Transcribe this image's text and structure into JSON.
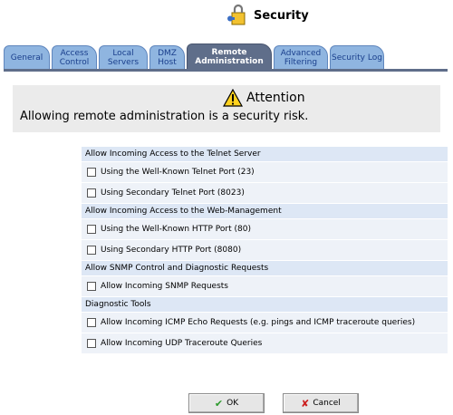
{
  "header": {
    "title": "Security",
    "icon": "lock-key-icon"
  },
  "tabs": [
    {
      "label": "General",
      "active": false
    },
    {
      "label": "Access Control",
      "active": false
    },
    {
      "label": "Local Servers",
      "active": false
    },
    {
      "label": "DMZ Host",
      "active": false
    },
    {
      "label": "Remote Administration",
      "active": true
    },
    {
      "label": "Advanced Filtering",
      "active": false
    },
    {
      "label": "Security Log",
      "active": false
    }
  ],
  "attention": {
    "title": "Attention",
    "message": "Allowing remote administration is a security risk."
  },
  "sections": [
    {
      "title": "Allow Incoming Access to the Telnet Server",
      "items": [
        {
          "label": "Using the Well-Known Telnet Port (23)",
          "checked": false
        },
        {
          "label": "Using Secondary Telnet Port (8023)",
          "checked": false
        }
      ]
    },
    {
      "title": "Allow Incoming Access to the Web-Management",
      "items": [
        {
          "label": "Using the Well-Known HTTP Port (80)",
          "checked": false
        },
        {
          "label": "Using Secondary HTTP Port (8080)",
          "checked": false
        }
      ]
    },
    {
      "title": "Allow SNMP Control and Diagnostic Requests",
      "items": [
        {
          "label": "Allow Incoming SNMP Requests",
          "checked": false
        }
      ]
    },
    {
      "title": "Diagnostic Tools",
      "items": [
        {
          "label": "Allow Incoming ICMP Echo Requests (e.g. pings and ICMP traceroute queries)",
          "checked": false
        },
        {
          "label": "Allow Incoming UDP Traceroute Queries",
          "checked": false
        }
      ]
    }
  ],
  "buttons": {
    "ok": "OK",
    "cancel": "Cancel"
  }
}
